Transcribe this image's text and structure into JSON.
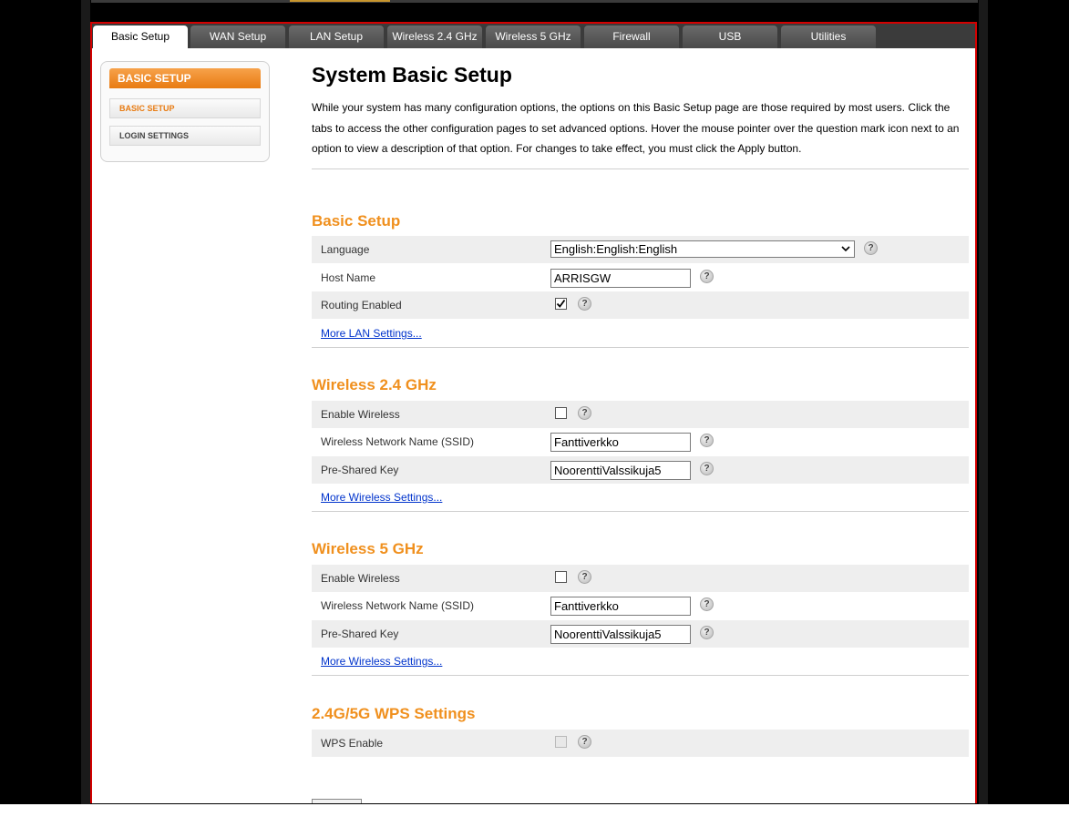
{
  "tabs": [
    {
      "label": "Basic Setup",
      "active": true
    },
    {
      "label": "WAN Setup"
    },
    {
      "label": "LAN Setup"
    },
    {
      "label": "Wireless 2.4 GHz"
    },
    {
      "label": "Wireless 5 GHz"
    },
    {
      "label": "Firewall"
    },
    {
      "label": "USB"
    },
    {
      "label": "Utilities"
    }
  ],
  "sidebar": {
    "heading": "BASIC SETUP",
    "items": [
      {
        "label": "BASIC SETUP",
        "active": true
      },
      {
        "label": "LOGIN SETTINGS"
      }
    ]
  },
  "page": {
    "title": "System Basic Setup",
    "intro": "While your system has many configuration options, the options on this Basic Setup page are those required by most users. Click the tabs to access the other configuration pages to set advanced options. Hover the mouse pointer over the question mark icon next to an option to view a description of that option. For changes to take effect, you must click the Apply button."
  },
  "basic": {
    "title": "Basic Setup",
    "language_label": "Language",
    "language_value": "English:English:English",
    "hostname_label": "Host Name",
    "hostname_value": "ARRISGW",
    "routing_label": "Routing Enabled",
    "routing_checked": true,
    "more_link": "More LAN Settings..."
  },
  "w24": {
    "title": "Wireless 2.4 GHz",
    "enable_label": "Enable Wireless",
    "enable_checked": false,
    "ssid_label": "Wireless Network Name (SSID)",
    "ssid_value": "Fanttiverkko",
    "psk_label": "Pre-Shared Key",
    "psk_value": "NoorenttiValssikuja5",
    "more_link": "More Wireless Settings..."
  },
  "w5": {
    "title": "Wireless 5 GHz",
    "enable_label": "Enable Wireless",
    "enable_checked": false,
    "ssid_label": "Wireless Network Name (SSID)",
    "ssid_value": "Fanttiverkko",
    "psk_label": "Pre-Shared Key",
    "psk_value": "NoorenttiValssikuja5",
    "more_link": "More Wireless Settings..."
  },
  "wps": {
    "title": "2.4G/5G WPS Settings",
    "enable_label": "WPS Enable",
    "enable_checked": false
  },
  "help_glyph": "?",
  "icons": {
    "help": "question-mark-icon",
    "check": "checkmark-icon",
    "dropdown": "chevron-down-icon"
  },
  "colors": {
    "accent": "#f0901e",
    "frame": "#d40000",
    "link": "#0033cc"
  }
}
